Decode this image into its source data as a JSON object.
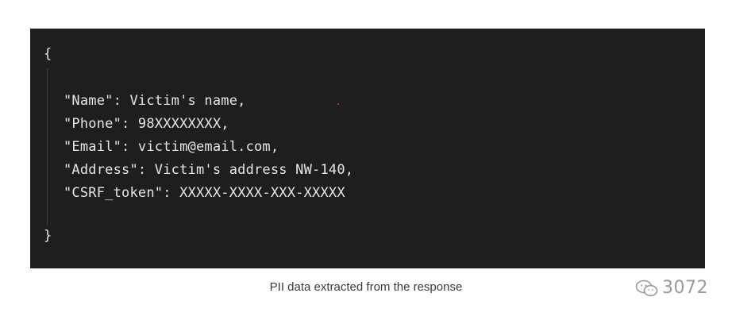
{
  "code_block": {
    "open_brace": "{",
    "close_brace": "}",
    "lines": [
      "\"Name\": Victim's name,",
      "\"Phone\": 98XXXXXXXX,",
      "\"Email\": victim@email.com,",
      "\"Address\": Victim's address NW-140,",
      "\"CSRF_token\": XXXXX-XXXX-XXX-XXXXX"
    ]
  },
  "caption": "PII data extracted from the response",
  "watermark": {
    "icon": "wechat-icon",
    "text": "3072"
  },
  "colors": {
    "code_background": "#1e1e1e",
    "code_text": "#e6e6e6",
    "caption_text": "#3a3a3a",
    "watermark": "#9a9a9a"
  }
}
